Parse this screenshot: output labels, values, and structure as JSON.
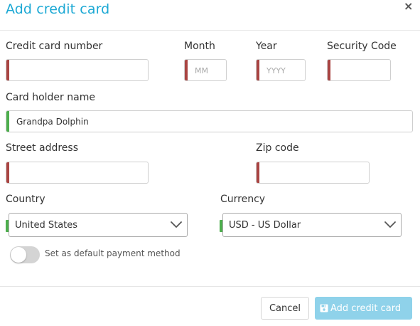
{
  "dialog": {
    "title": "Add credit card",
    "close_glyph": "×"
  },
  "form": {
    "card_number": {
      "label": "Credit card number",
      "value": "",
      "placeholder": ""
    },
    "month": {
      "label": "Month",
      "value": "",
      "placeholder": "MM"
    },
    "year": {
      "label": "Year",
      "value": "",
      "placeholder": "YYYY"
    },
    "security_code": {
      "label": "Security Code",
      "value": "",
      "placeholder": ""
    },
    "card_holder": {
      "label": "Card holder name",
      "value": "Grandpa Dolphin",
      "placeholder": ""
    },
    "street": {
      "label": "Street address",
      "value": "",
      "placeholder": ""
    },
    "zip": {
      "label": "Zip code",
      "value": "",
      "placeholder": ""
    },
    "country": {
      "label": "Country",
      "selected": "United States"
    },
    "currency": {
      "label": "Currency",
      "selected": "USD - US Dollar"
    },
    "default_toggle": {
      "label": "Set as default payment method",
      "checked": false
    }
  },
  "footer": {
    "cancel_label": "Cancel",
    "submit_label": "Add credit card",
    "submit_icon": "floppy-disk-icon"
  },
  "colors": {
    "accent": "#1ba8d4",
    "invalid": "#a94442",
    "valid": "#4cae4c",
    "submit_disabled": "#8fd2ea"
  }
}
